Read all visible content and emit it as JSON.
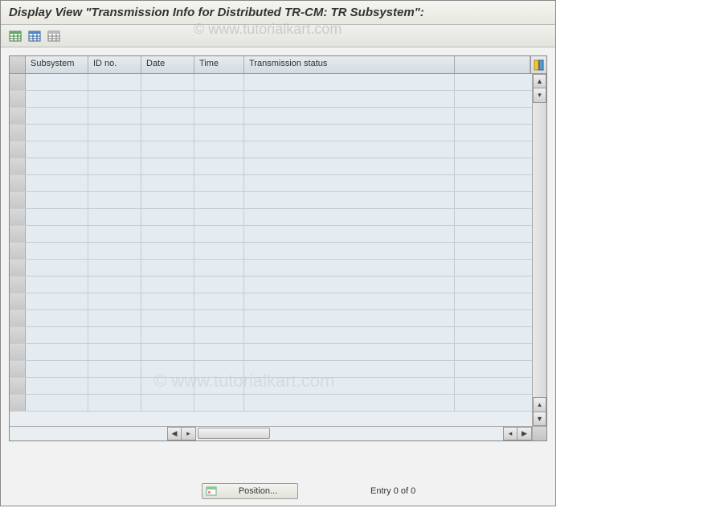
{
  "title": "Display View \"Transmission Info for Distributed TR-CM: TR Subsystem\":",
  "watermark": "© www.tutorialkart.com",
  "toolbar": {
    "icon1": "table-green-icon",
    "icon2": "table-blue-icon",
    "icon3": "table-gray-icon"
  },
  "grid": {
    "columns": [
      "Subsystem",
      "ID no.",
      "Date",
      "Time",
      "Transmission status"
    ],
    "row_count": 20
  },
  "footer": {
    "position_label": "Position...",
    "entry_text": "Entry 0 of 0"
  }
}
